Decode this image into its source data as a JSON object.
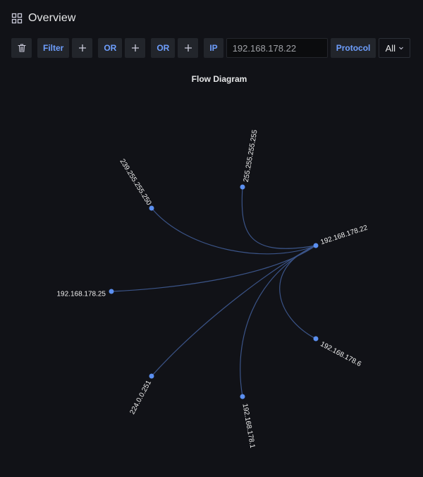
{
  "header": {
    "title": "Overview",
    "icon": "grid-icon"
  },
  "toolbar": {
    "filter_label": "Filter",
    "or1_label": "OR",
    "or2_label": "OR",
    "ip_label": "IP",
    "ip_value": "192.168.178.22",
    "protocol_label": "Protocol",
    "protocol_selected": "All"
  },
  "diagram": {
    "title": "Flow Diagram",
    "line_color": "#3b5488",
    "node_color": "#5b8ff0",
    "center": {
      "label": "192.168.178.22"
    },
    "nodes": [
      {
        "id": "n1",
        "label": "255.255.255.255"
      },
      {
        "id": "n2",
        "label": "239.255.255.250"
      },
      {
        "id": "n3",
        "label": "192.168.178.25"
      },
      {
        "id": "n4",
        "label": "224.0.0.251"
      },
      {
        "id": "n5",
        "label": "192.168.178.1"
      },
      {
        "id": "n6",
        "label": "192.168.178.6"
      }
    ]
  }
}
